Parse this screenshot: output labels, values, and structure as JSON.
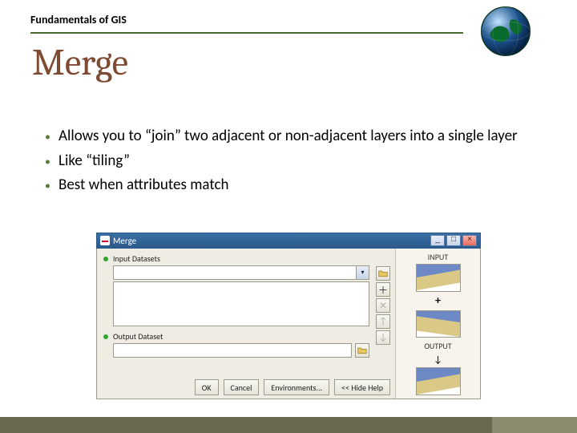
{
  "course_title": "Fundamentals of GIS",
  "slide_title": "Merge",
  "bullets": [
    "Allows you to “join” two adjacent or non-adjacent layers into a single layer",
    "Like “tiling”",
    "Best when attributes match"
  ],
  "dialog": {
    "window_title": "Merge",
    "input_label": "Input Datasets",
    "output_label": "Output Dataset",
    "output_value": "",
    "buttons": {
      "ok": "OK",
      "cancel": "Cancel",
      "environments": "Environments...",
      "hide_help": "<< Hide Help"
    },
    "side_icons": [
      "folder",
      "plus",
      "remove",
      "up",
      "down"
    ],
    "help": {
      "input_heading": "INPUT",
      "output_heading": "OUTPUT"
    }
  }
}
